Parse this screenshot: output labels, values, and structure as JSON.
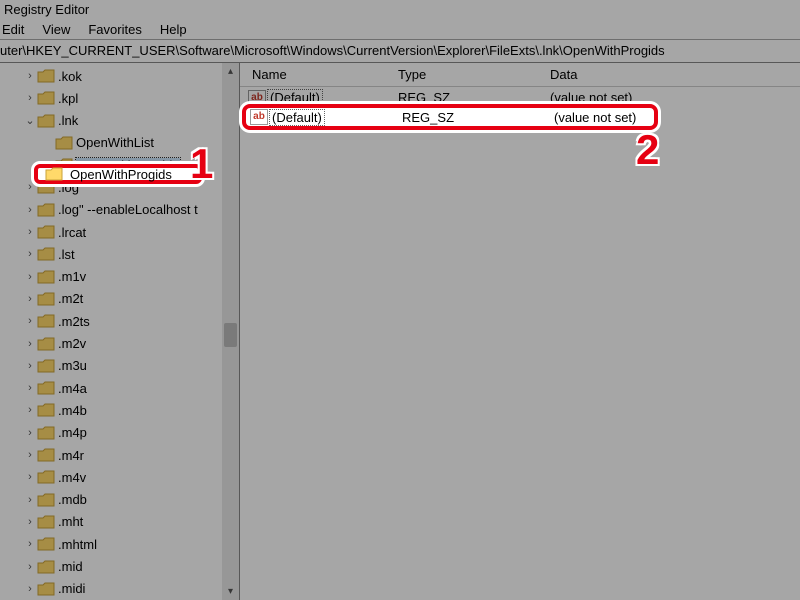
{
  "window": {
    "title": "Registry Editor"
  },
  "menubar": {
    "items": [
      "Edit",
      "View",
      "Favorites",
      "Help"
    ]
  },
  "addressbar": {
    "path": "uter\\HKEY_CURRENT_USER\\Software\\Microsoft\\Windows\\CurrentVersion\\Explorer\\FileExts\\.lnk\\OpenWithProgids"
  },
  "tree": {
    "nodes": [
      {
        "indent": 1,
        "expander": ">",
        "label": ".kok"
      },
      {
        "indent": 1,
        "expander": ">",
        "label": ".kpl"
      },
      {
        "indent": 1,
        "expander": "v",
        "label": ".lnk"
      },
      {
        "indent": 2,
        "expander": "",
        "label": "OpenWithList"
      },
      {
        "indent": 2,
        "expander": "",
        "label": "OpenWithProgids",
        "selected": true
      },
      {
        "indent": 1,
        "expander": ">",
        "label": ".log"
      },
      {
        "indent": 1,
        "expander": ">",
        "label": ".log\" --enableLocalhost t"
      },
      {
        "indent": 1,
        "expander": ">",
        "label": ".lrcat"
      },
      {
        "indent": 1,
        "expander": ">",
        "label": ".lst"
      },
      {
        "indent": 1,
        "expander": ">",
        "label": ".m1v"
      },
      {
        "indent": 1,
        "expander": ">",
        "label": ".m2t"
      },
      {
        "indent": 1,
        "expander": ">",
        "label": ".m2ts"
      },
      {
        "indent": 1,
        "expander": ">",
        "label": ".m2v"
      },
      {
        "indent": 1,
        "expander": ">",
        "label": ".m3u"
      },
      {
        "indent": 1,
        "expander": ">",
        "label": ".m4a"
      },
      {
        "indent": 1,
        "expander": ">",
        "label": ".m4b"
      },
      {
        "indent": 1,
        "expander": ">",
        "label": ".m4p"
      },
      {
        "indent": 1,
        "expander": ">",
        "label": ".m4r"
      },
      {
        "indent": 1,
        "expander": ">",
        "label": ".m4v"
      },
      {
        "indent": 1,
        "expander": ">",
        "label": ".mdb"
      },
      {
        "indent": 1,
        "expander": ">",
        "label": ".mht"
      },
      {
        "indent": 1,
        "expander": ">",
        "label": ".mhtml"
      },
      {
        "indent": 1,
        "expander": ">",
        "label": ".mid"
      },
      {
        "indent": 1,
        "expander": ">",
        "label": ".midi"
      }
    ]
  },
  "values": {
    "columns": {
      "name": "Name",
      "type": "Type",
      "data": "Data"
    },
    "rows": [
      {
        "icon": "ab",
        "name": "(Default)",
        "type": "REG_SZ",
        "data": "(value not set)"
      }
    ]
  },
  "callouts": {
    "one": {
      "label": "OpenWithProgids",
      "num": "1"
    },
    "two": {
      "name": "(Default)",
      "type": "REG_SZ",
      "data": "(value not set)",
      "num": "2"
    }
  }
}
